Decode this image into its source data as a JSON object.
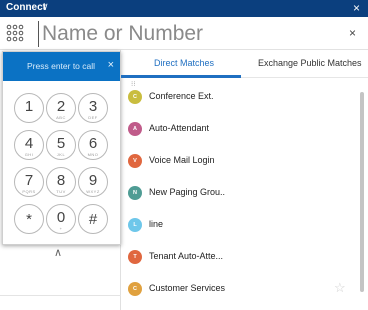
{
  "titlebar": {
    "title": "Connect",
    "caret": "∨",
    "close": "×"
  },
  "search": {
    "placeholder": "Name or Number",
    "clear": "×"
  },
  "dialpad": {
    "hint": "Press enter to call",
    "close": "×",
    "collapse": "∧",
    "keys": [
      {
        "digit": "1",
        "letters": ""
      },
      {
        "digit": "2",
        "letters": "ABC"
      },
      {
        "digit": "3",
        "letters": "DEF"
      },
      {
        "digit": "4",
        "letters": "GHI"
      },
      {
        "digit": "5",
        "letters": "JKL"
      },
      {
        "digit": "6",
        "letters": "MNO"
      },
      {
        "digit": "7",
        "letters": "PQRS"
      },
      {
        "digit": "8",
        "letters": "TUV"
      },
      {
        "digit": "9",
        "letters": "WXYZ"
      },
      {
        "digit": "*",
        "letters": ""
      },
      {
        "digit": "0",
        "letters": "+"
      },
      {
        "digit": "#",
        "letters": ""
      }
    ]
  },
  "tabs": [
    {
      "label": "Direct Matches",
      "active": true
    },
    {
      "label": "Exchange Public Matches",
      "active": false
    }
  ],
  "results": [
    {
      "name": "Conference Ext.",
      "initial": "C",
      "color": "#c9bd3f"
    },
    {
      "name": "Auto-Attendant",
      "initial": "A",
      "color": "#c05b8a"
    },
    {
      "name": "Voice Mail Login",
      "initial": "V",
      "color": "#e0673f"
    },
    {
      "name": "New Paging Grou..",
      "initial": "N",
      "color": "#4f9c94"
    },
    {
      "name": "line",
      "initial": "L",
      "color": "#6ec7ea"
    },
    {
      "name": "Tenant Auto-Atte...",
      "initial": "T",
      "color": "#e0673f"
    },
    {
      "name": "Customer Services",
      "initial": "C",
      "color": "#e0a13f"
    }
  ],
  "hover_icon": "⁝⁝",
  "favorite_icon": "☆"
}
